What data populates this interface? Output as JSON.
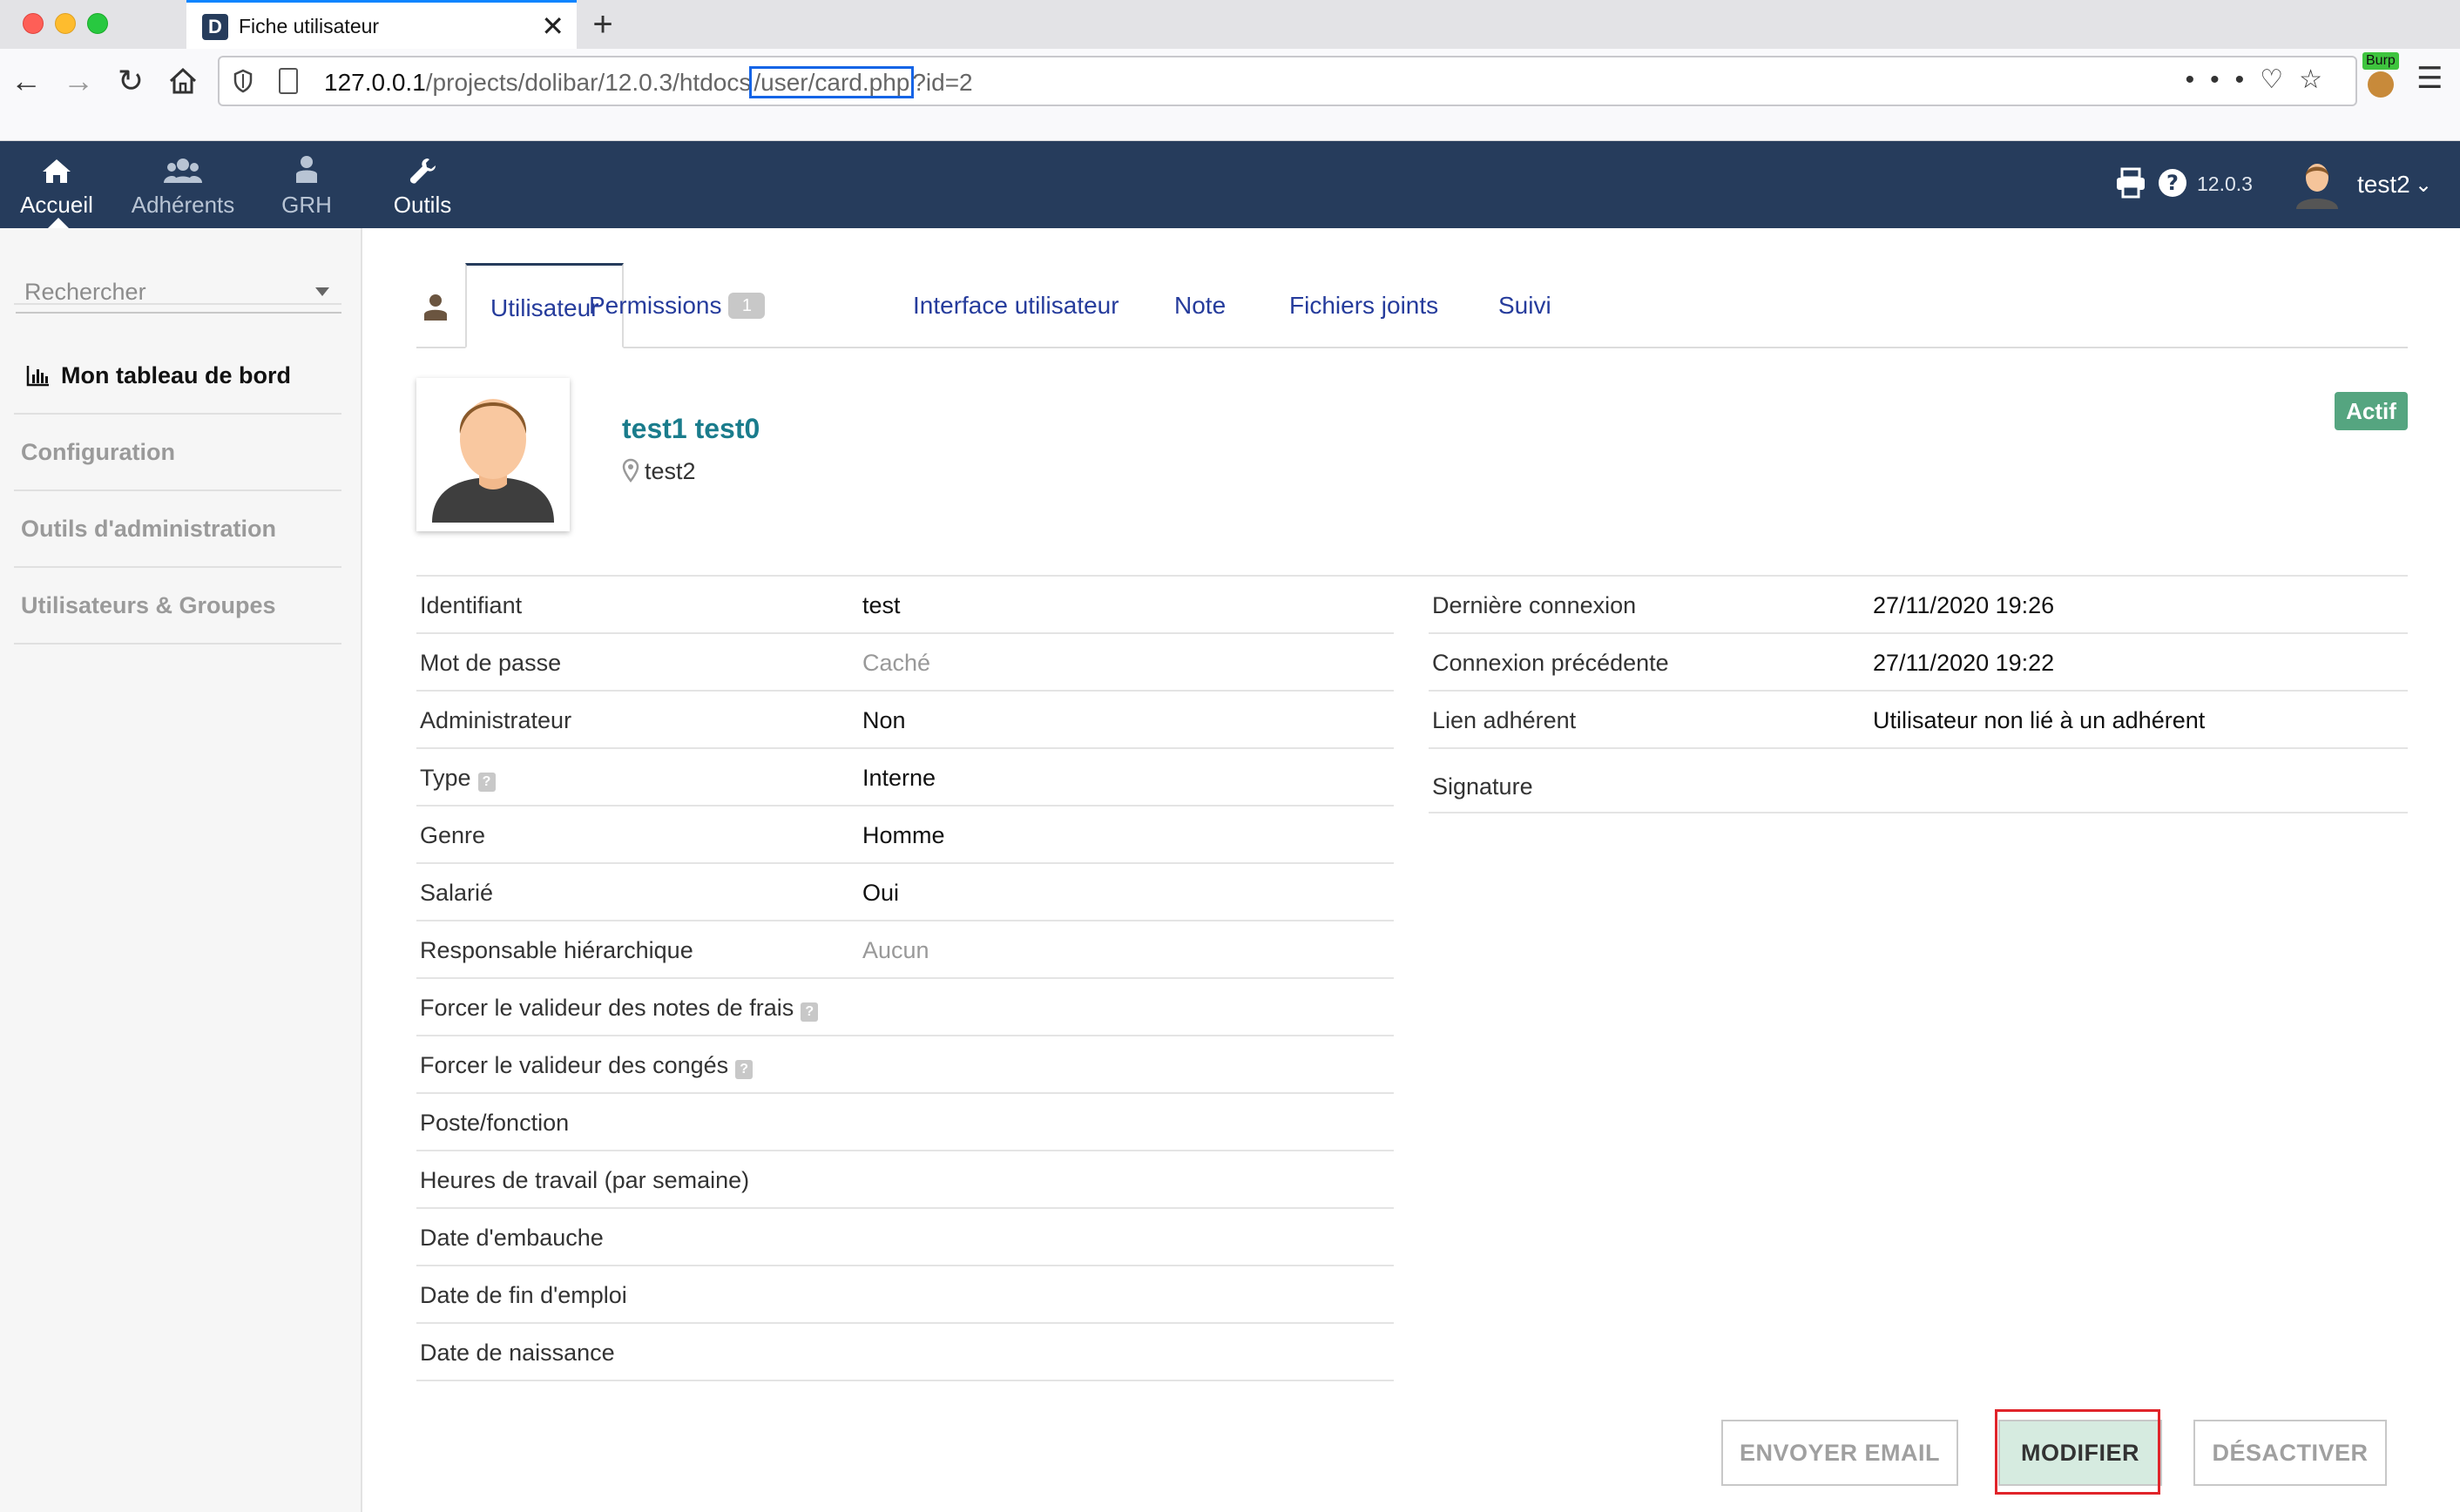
{
  "browser": {
    "tab_title": "Fiche utilisateur",
    "favicon_letter": "D",
    "url_host": "127.0.0.1",
    "url_path_before": "/projects/dolibar/12.0.3/htdocs",
    "url_path_highlight": "/user/card.php",
    "url_query": "?id=2",
    "extension_label": "Burp"
  },
  "topmenu": {
    "items": [
      {
        "label": "Accueil",
        "icon": "home-icon"
      },
      {
        "label": "Adhérents",
        "icon": "users-icon"
      },
      {
        "label": "GRH",
        "icon": "person-icon"
      },
      {
        "label": "Outils",
        "icon": "wrench-icon"
      }
    ],
    "version": "12.0.3",
    "user_name": "test2"
  },
  "sidebar": {
    "search_placeholder": "Rechercher",
    "items": [
      {
        "label": "Mon tableau de bord"
      },
      {
        "label": "Configuration"
      },
      {
        "label": "Outils d'administration"
      },
      {
        "label": "Utilisateurs & Groupes"
      }
    ]
  },
  "tabs": [
    {
      "label": "Utilisateur"
    },
    {
      "label": "Permissions",
      "badge": "1"
    },
    {
      "label": "Interface utilisateur"
    },
    {
      "label": "Note"
    },
    {
      "label": "Fichiers joints"
    },
    {
      "label": "Suivi"
    }
  ],
  "user": {
    "fullname": "test1 test0",
    "login": "test2",
    "status": "Actif"
  },
  "fields_left": [
    {
      "label": "Identifiant",
      "value": "test"
    },
    {
      "label": "Mot de passe",
      "value": "Caché"
    },
    {
      "label": "Administrateur",
      "value": "Non"
    },
    {
      "label": "Type",
      "value": "Interne"
    },
    {
      "label": "Genre",
      "value": "Homme"
    },
    {
      "label": "Salarié",
      "value": "Oui"
    },
    {
      "label": "Responsable hiérarchique",
      "value": "Aucun"
    },
    {
      "label": "Forcer le valideur des notes de frais",
      "value": ""
    },
    {
      "label": "Forcer le valideur des congés",
      "value": ""
    },
    {
      "label": "Poste/fonction",
      "value": ""
    },
    {
      "label": "Heures de travail (par semaine)",
      "value": ""
    },
    {
      "label": "Date d'embauche",
      "value": ""
    },
    {
      "label": "Date de fin d'emploi",
      "value": ""
    },
    {
      "label": "Date de naissance",
      "value": ""
    }
  ],
  "fields_right": [
    {
      "label": "Dernière connexion",
      "value": "27/11/2020 19:26"
    },
    {
      "label": "Connexion précédente",
      "value": "27/11/2020 19:22"
    },
    {
      "label": "Lien adhérent",
      "value": "Utilisateur non lié à un adhérent"
    },
    {
      "label": "Signature",
      "value": ""
    }
  ],
  "actions": {
    "email": "ENVOYER EMAIL",
    "modify": "MODIFIER",
    "deactivate": "DÉSACTIVER"
  },
  "colors": {
    "topmenu_bg": "#263c5c",
    "status_green": "#55a580",
    "name_teal": "#1a7c8c",
    "highlight_red": "#e0242a",
    "url_highlight_blue": "#1464e6"
  }
}
